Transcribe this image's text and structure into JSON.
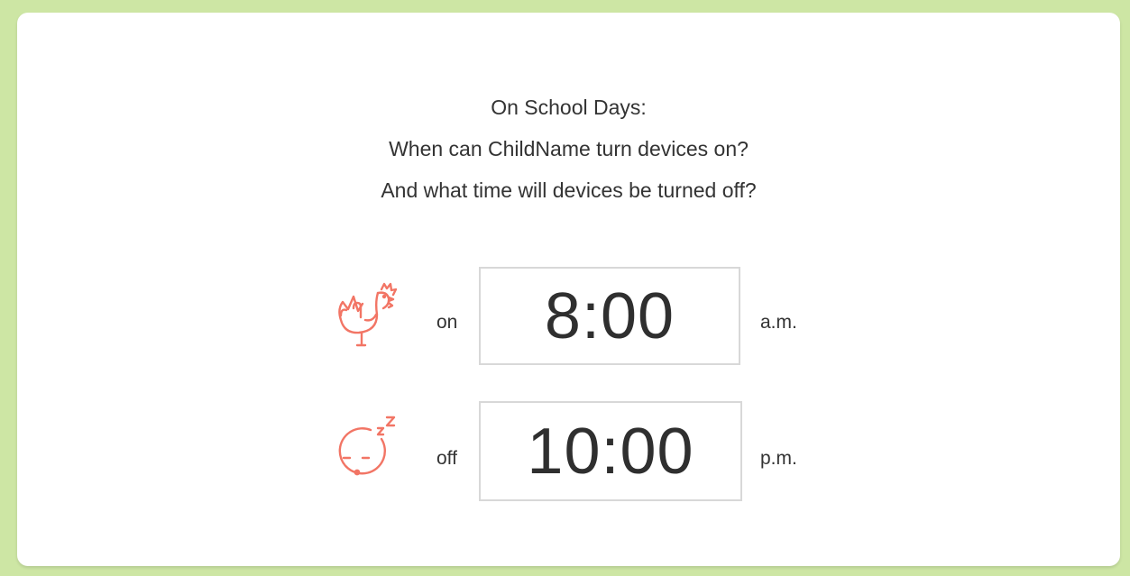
{
  "heading": {
    "line1": "On School Days:",
    "line2": "When can ChildName turn devices on?",
    "line3": "And what time will devices be turned off?"
  },
  "schedule": {
    "on": {
      "icon": "rooster-icon",
      "label": "on",
      "time": "8:00",
      "meridiem": "a.m."
    },
    "off": {
      "icon": "sleeping-face-icon",
      "label": "off",
      "time": "10:00",
      "meridiem": "p.m."
    }
  },
  "colors": {
    "background": "#cde6a4",
    "icon": "#f27565",
    "text": "#333333",
    "box_border": "#d8d8d8"
  }
}
